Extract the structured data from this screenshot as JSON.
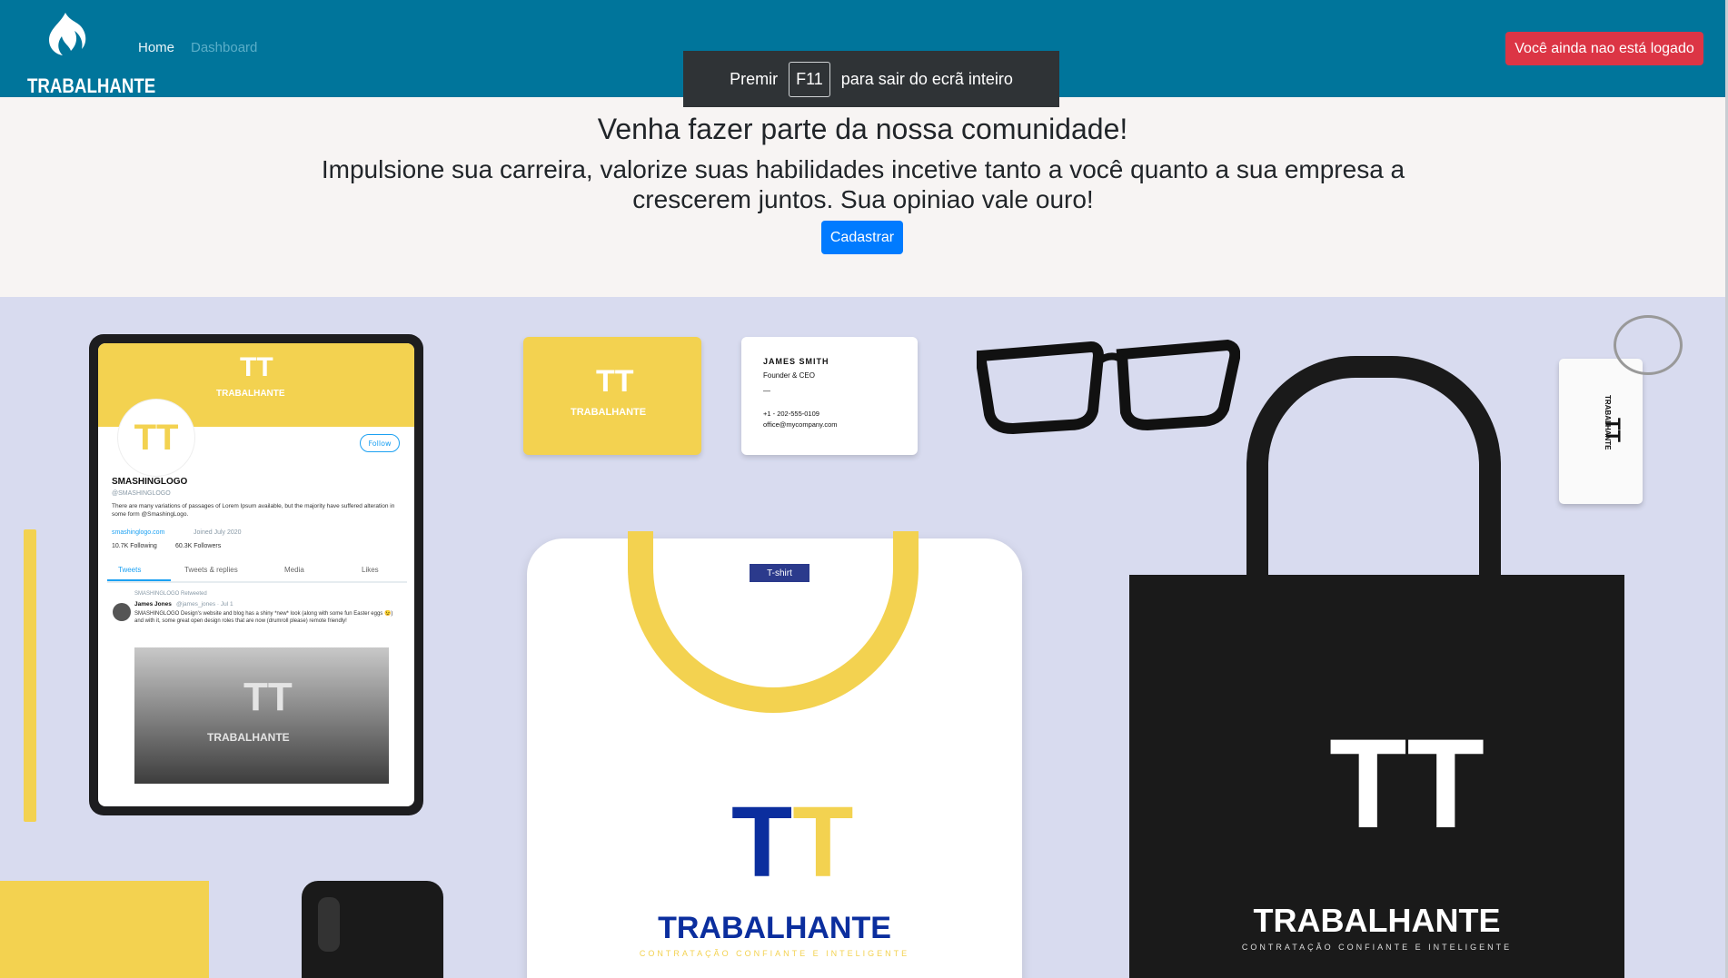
{
  "navbar": {
    "brand": "TRABALHANTE",
    "links": [
      "Home",
      "Dashboard"
    ],
    "login_status": "Você ainda nao está logado",
    "colors": {
      "background": "#00759b",
      "login_button": "#dc3545"
    }
  },
  "fullscreen_notice": {
    "before": "Premir",
    "key": "F11",
    "after": "para sair do ecrã inteiro"
  },
  "hero": {
    "title": "Venha fazer parte da nossa comunidade!",
    "subtitle": "Impulsione sua carreira, valorize suas habilidades incetive tanto a você quanto a sua empresa a crescerem juntos. Sua opiniao vale ouro!",
    "cta": "Cadastrar"
  },
  "mockup": {
    "brand": "TRABALHANTE",
    "slogan": "CONTRATAÇÃO CONFIANTE E INTELIGENTE",
    "monogram": "TT",
    "profile": {
      "name": "SMASHINGLOGO",
      "handle": "@SMASHINGLOGO",
      "bio": "There are many variations of passages of Lorem Ipsum available, but the majority have suffered alteration in some form @SmashingLogo.",
      "website": "smashinglogo.com",
      "joined": "Joined July 2020",
      "following": "10.7K Following",
      "followers": "60.3K Followers",
      "follow_button": "Follow",
      "tabs": [
        "Tweets",
        "Tweets & replies",
        "Media",
        "Likes"
      ],
      "retweet_label": "SMASHINGLOGO Retweeted",
      "tweet_author": "James Jones",
      "tweet_meta": "@james_jones · Jul 1",
      "tweet_text": "SMASHINGLOGO Design's website and blog has a shiny *new* look (along with some fun Easter eggs 😉) and with it, some great open design roles that are now (drumroll please) remote friendly!"
    },
    "business_card": {
      "name": "JAMES SMITH",
      "title": "Founder & CEO",
      "divider": "—",
      "phone": "+1 - 202-555-0109",
      "email": "office@mycompany.com"
    },
    "shirt_tag": "T-shirt"
  }
}
